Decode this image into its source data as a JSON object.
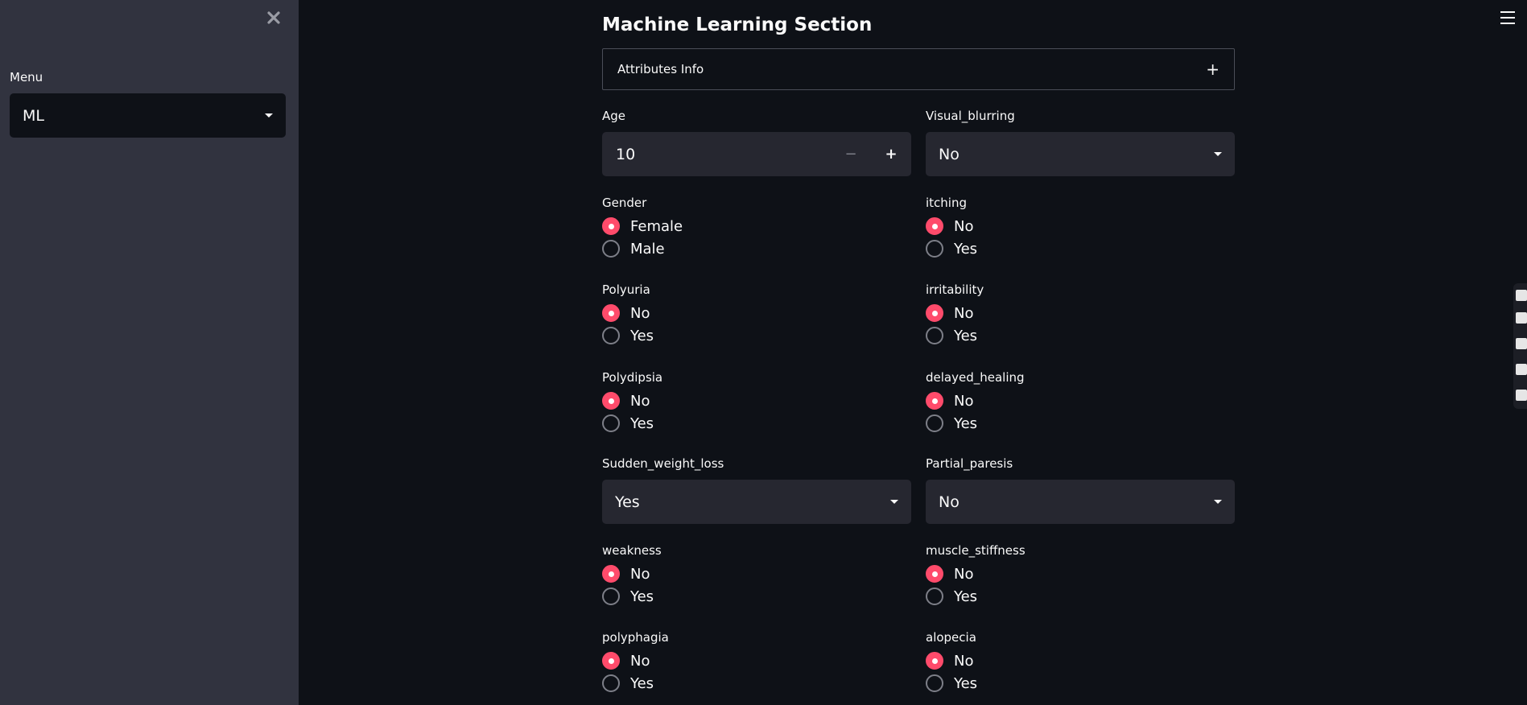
{
  "sidebar": {
    "close_icon": "close-icon",
    "menu_label": "Menu",
    "menu_value": "ML"
  },
  "main": {
    "title": "Machine Learning Section",
    "expander_label": "Attributes Info",
    "expander_icon": "+"
  },
  "fields": {
    "age": {
      "label": "Age",
      "value": "10",
      "minus": "−",
      "plus": "+"
    },
    "visual_blurring": {
      "label": "Visual_blurring",
      "value": "No"
    },
    "gender": {
      "label": "Gender",
      "options": [
        "Female",
        "Male"
      ],
      "selected": "Female"
    },
    "itching": {
      "label": "itching",
      "options": [
        "No",
        "Yes"
      ],
      "selected": "No"
    },
    "polyuria": {
      "label": "Polyuria",
      "options": [
        "No",
        "Yes"
      ],
      "selected": "No"
    },
    "irritability": {
      "label": "irritability",
      "options": [
        "No",
        "Yes"
      ],
      "selected": "No"
    },
    "polydipsia": {
      "label": "Polydipsia",
      "options": [
        "No",
        "Yes"
      ],
      "selected": "No"
    },
    "delayed_healing": {
      "label": "delayed_healing",
      "options": [
        "No",
        "Yes"
      ],
      "selected": "No"
    },
    "sudden_weight_loss": {
      "label": "Sudden_weight_loss",
      "value": "Yes"
    },
    "partial_paresis": {
      "label": "Partial_paresis",
      "value": "No"
    },
    "weakness": {
      "label": "weakness",
      "options": [
        "No",
        "Yes"
      ],
      "selected": "No"
    },
    "muscle_stiffness": {
      "label": "muscle_stiffness",
      "options": [
        "No",
        "Yes"
      ],
      "selected": "No"
    },
    "polyphagia": {
      "label": "polyphagia",
      "options": [
        "No",
        "Yes"
      ],
      "selected": "No"
    },
    "alopecia": {
      "label": "alopecia",
      "options": [
        "No",
        "Yes"
      ],
      "selected": "No"
    }
  },
  "colors": {
    "accent": "#ff4b6b",
    "sidebar_bg": "#31333f",
    "main_bg": "#0e1117",
    "widget_bg": "#262730"
  }
}
